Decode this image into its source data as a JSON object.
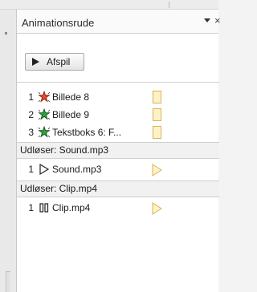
{
  "pane": {
    "title": "Animationsrude",
    "menu_icon": "dropdown-arrow-icon",
    "close_glyph": "×"
  },
  "toolbar": {
    "play_label": "Afspil"
  },
  "effects": [
    {
      "num": "1",
      "icon": "star-red-icon",
      "label": "Billede 8"
    },
    {
      "num": "2",
      "icon": "star-green-icon",
      "label": "Billede 9"
    },
    {
      "num": "3",
      "icon": "star-green-icon",
      "label": "Tekstboks 6: F..."
    }
  ],
  "trigger_sound": {
    "header": "Udløser: Sound.mp3",
    "item": {
      "num": "1",
      "icon": "play-icon",
      "label": "Sound.mp3"
    }
  },
  "trigger_clip": {
    "header": "Udløser: Clip.mp4",
    "item": {
      "num": "1",
      "icon": "pause-icon",
      "label": "Clip.mp4"
    }
  },
  "colors": {
    "timeline_fill": "#fff2c6",
    "timeline_border": "#d8b35a",
    "star_red": "#e8462a",
    "star_green": "#2f9e3a"
  }
}
